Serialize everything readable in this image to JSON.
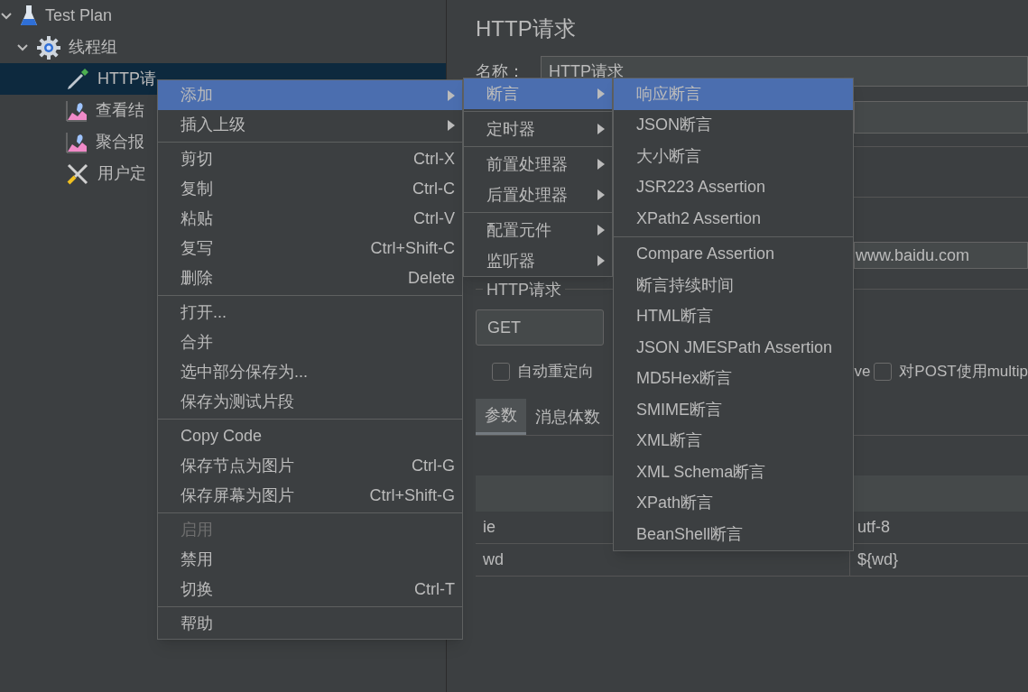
{
  "tree": [
    {
      "label": "Test Plan",
      "kind": "plan",
      "expanded": true,
      "selected": false,
      "children": [
        {
          "label": "线程组",
          "kind": "thread-group",
          "expanded": true,
          "selected": false,
          "children": [
            {
              "label": "HTTP请",
              "kind": "sampler",
              "selected": true
            },
            {
              "label": "查看结",
              "kind": "listener",
              "selected": false
            },
            {
              "label": "聚合报",
              "kind": "listener",
              "selected": false
            },
            {
              "label": "用户定",
              "kind": "config",
              "selected": false
            }
          ]
        }
      ]
    }
  ],
  "editor": {
    "title": "HTTP请求",
    "name_label": "名称：",
    "name_value": "HTTP请求",
    "server_value": "www.baidu.com",
    "section_label": "HTTP请求",
    "method": "GET",
    "options": [
      {
        "label": "自动重定向",
        "checked": false
      },
      {
        "label": "ve"
      },
      {
        "label": "对POST使用multip",
        "checked": false
      }
    ],
    "tabs": [
      {
        "label": "参数",
        "selected": true
      },
      {
        "label": "消息体数",
        "selected": false
      }
    ],
    "rows": [
      {
        "name": "ie",
        "value": "utf-8"
      },
      {
        "name": "wd",
        "value": "${wd}"
      }
    ]
  },
  "context_menu": {
    "groups": [
      [
        {
          "label": "添加",
          "submenu": true,
          "selected": true,
          "disabled": false
        },
        {
          "label": "插入上级",
          "submenu": true,
          "selected": false,
          "disabled": false
        }
      ],
      [
        {
          "label": "剪切",
          "shortcut": "Ctrl-X",
          "submenu": false,
          "selected": false,
          "disabled": false
        },
        {
          "label": "复制",
          "shortcut": "Ctrl-C",
          "submenu": false,
          "selected": false,
          "disabled": false
        },
        {
          "label": "粘贴",
          "shortcut": "Ctrl-V",
          "submenu": false,
          "selected": false,
          "disabled": false
        },
        {
          "label": "复写",
          "shortcut": "Ctrl+Shift-C",
          "submenu": false,
          "selected": false,
          "disabled": false
        },
        {
          "label": "删除",
          "shortcut": "Delete",
          "submenu": false,
          "selected": false,
          "disabled": false
        }
      ],
      [
        {
          "label": "打开...",
          "submenu": false,
          "selected": false,
          "disabled": false
        },
        {
          "label": "合并",
          "submenu": false,
          "selected": false,
          "disabled": false
        },
        {
          "label": "选中部分保存为...",
          "submenu": false,
          "selected": false,
          "disabled": false
        },
        {
          "label": "保存为测试片段",
          "submenu": false,
          "selected": false,
          "disabled": false
        }
      ],
      [
        {
          "label": "Copy Code",
          "submenu": false,
          "selected": false,
          "disabled": false
        },
        {
          "label": "保存节点为图片",
          "shortcut": "Ctrl-G",
          "submenu": false,
          "selected": false,
          "disabled": false
        },
        {
          "label": "保存屏幕为图片",
          "shortcut": "Ctrl+Shift-G",
          "submenu": false,
          "selected": false,
          "disabled": false
        }
      ],
      [
        {
          "label": "启用",
          "submenu": false,
          "selected": false,
          "disabled": true
        },
        {
          "label": "禁用",
          "submenu": false,
          "selected": false,
          "disabled": false
        },
        {
          "label": "切换",
          "shortcut": "Ctrl-T",
          "submenu": false,
          "selected": false,
          "disabled": false
        }
      ],
      [
        {
          "label": "帮助",
          "submenu": false,
          "selected": false,
          "disabled": false
        }
      ]
    ]
  },
  "add_submenu": {
    "groups": [
      [
        {
          "label": "断言",
          "submenu": true,
          "selected": true
        }
      ],
      [
        {
          "label": "定时器",
          "submenu": true,
          "selected": false
        }
      ],
      [
        {
          "label": "前置处理器",
          "submenu": true,
          "selected": false
        },
        {
          "label": "后置处理器",
          "submenu": true,
          "selected": false
        }
      ],
      [
        {
          "label": "配置元件",
          "submenu": true,
          "selected": false
        },
        {
          "label": "监听器",
          "submenu": true,
          "selected": false
        }
      ]
    ]
  },
  "assertion_submenu": {
    "groups": [
      [
        {
          "label": "响应断言",
          "selected": true
        },
        {
          "label": "JSON断言",
          "selected": false
        },
        {
          "label": "大小断言",
          "selected": false
        },
        {
          "label": "JSR223 Assertion",
          "selected": false
        },
        {
          "label": "XPath2 Assertion",
          "selected": false
        }
      ],
      [
        {
          "label": "Compare Assertion",
          "selected": false
        },
        {
          "label": "断言持续时间",
          "selected": false
        },
        {
          "label": "HTML断言",
          "selected": false
        },
        {
          "label": "JSON JMESPath Assertion",
          "selected": false
        },
        {
          "label": "MD5Hex断言",
          "selected": false
        },
        {
          "label": "SMIME断言",
          "selected": false
        },
        {
          "label": "XML断言",
          "selected": false
        },
        {
          "label": "XML Schema断言",
          "selected": false
        },
        {
          "label": "XPath断言",
          "selected": false
        },
        {
          "label": "BeanShell断言",
          "selected": false
        }
      ]
    ]
  }
}
